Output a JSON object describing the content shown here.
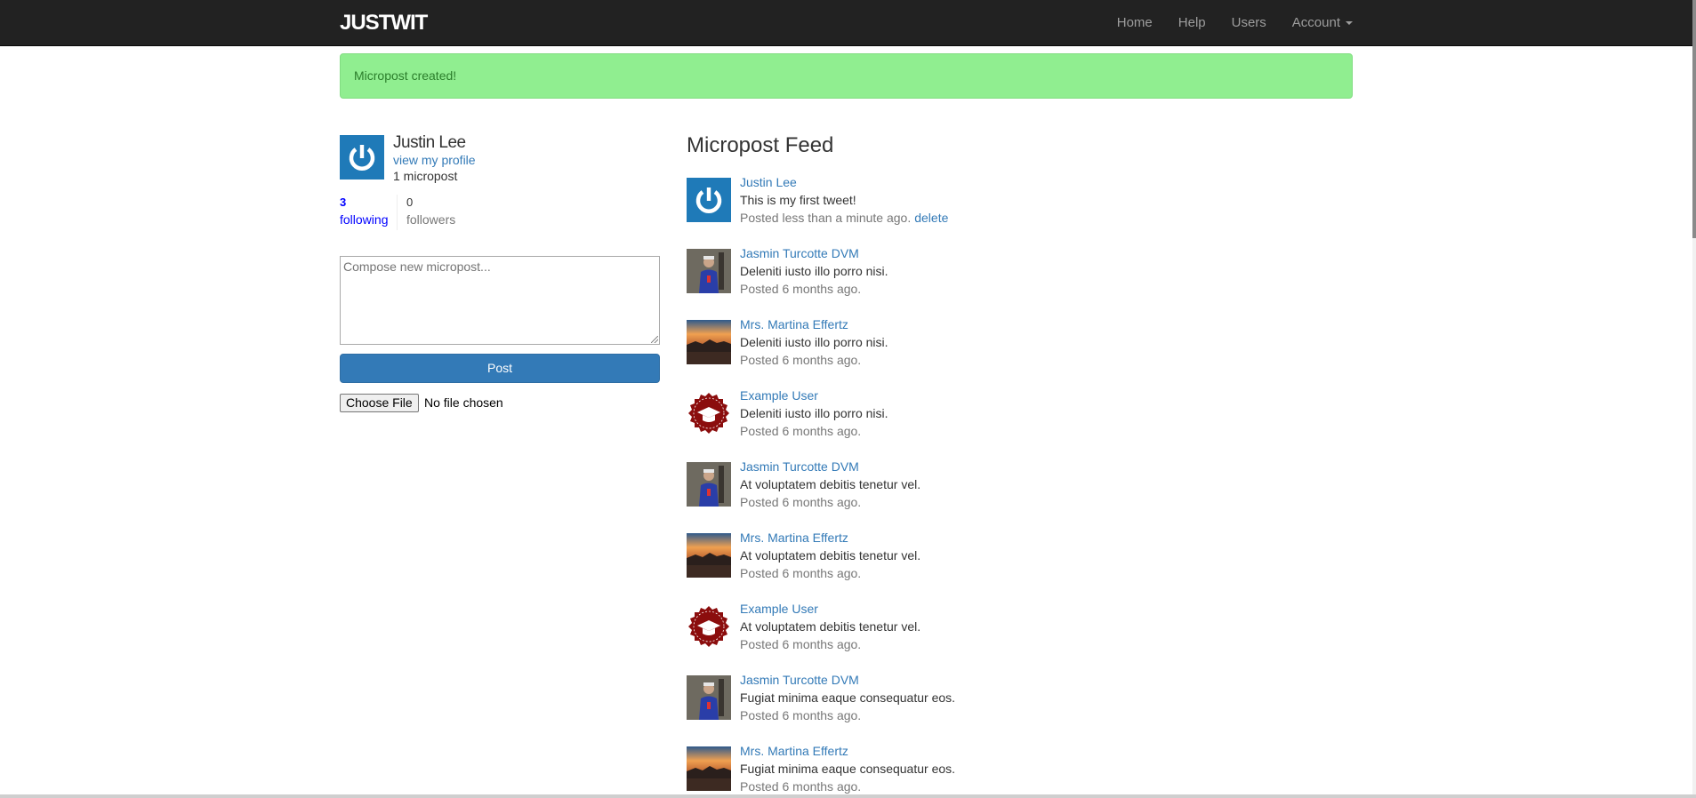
{
  "navbar": {
    "brand": "JUSTWIT",
    "links": [
      {
        "label": "Home"
      },
      {
        "label": "Help"
      },
      {
        "label": "Users"
      },
      {
        "label": "Account"
      }
    ]
  },
  "alert": {
    "message": "Micropost created!",
    "color": "#90ee90"
  },
  "profile": {
    "name": "Justin Lee",
    "view_profile": "view my profile",
    "micropost_count": "1 micropost",
    "avatar_icon": "power-icon"
  },
  "stats": {
    "following_count": "3",
    "following_label": "following",
    "followers_count": "0",
    "followers_label": "followers"
  },
  "compose": {
    "placeholder": "Compose new micropost...",
    "post_label": "Post",
    "file_button": "Choose File",
    "file_status": "No file chosen"
  },
  "feed": {
    "title": "Micropost Feed",
    "items": [
      {
        "user": "Justin Lee",
        "content": "This is my first tweet!",
        "time": "Posted less than a minute ago.",
        "delete": "delete",
        "avatar": "power-icon"
      },
      {
        "user": "Jasmin Turcotte DVM",
        "content": "Deleniti iusto illo porro nisi.",
        "time": "Posted 6 months ago.",
        "avatar": "person-photo"
      },
      {
        "user": "Mrs. Martina Effertz",
        "content": "Deleniti iusto illo porro nisi.",
        "time": "Posted 6 months ago.",
        "avatar": "sunset-photo"
      },
      {
        "user": "Example User",
        "content": "Deleniti iusto illo porro nisi.",
        "time": "Posted 6 months ago.",
        "avatar": "graduation-cap-badge"
      },
      {
        "user": "Jasmin Turcotte DVM",
        "content": "At voluptatem debitis tenetur vel.",
        "time": "Posted 6 months ago.",
        "avatar": "person-photo"
      },
      {
        "user": "Mrs. Martina Effertz",
        "content": "At voluptatem debitis tenetur vel.",
        "time": "Posted 6 months ago.",
        "avatar": "sunset-photo"
      },
      {
        "user": "Example User",
        "content": "At voluptatem debitis tenetur vel.",
        "time": "Posted 6 months ago.",
        "avatar": "graduation-cap-badge"
      },
      {
        "user": "Jasmin Turcotte DVM",
        "content": "Fugiat minima eaque consequatur eos.",
        "time": "Posted 6 months ago.",
        "avatar": "person-photo"
      },
      {
        "user": "Mrs. Martina Effertz",
        "content": "Fugiat minima eaque consequatur eos.",
        "time": "Posted 6 months ago.",
        "avatar": "sunset-photo"
      }
    ]
  },
  "colors": {
    "link": "#337ab7",
    "navbar": "#222222",
    "button": "#337ab7"
  }
}
